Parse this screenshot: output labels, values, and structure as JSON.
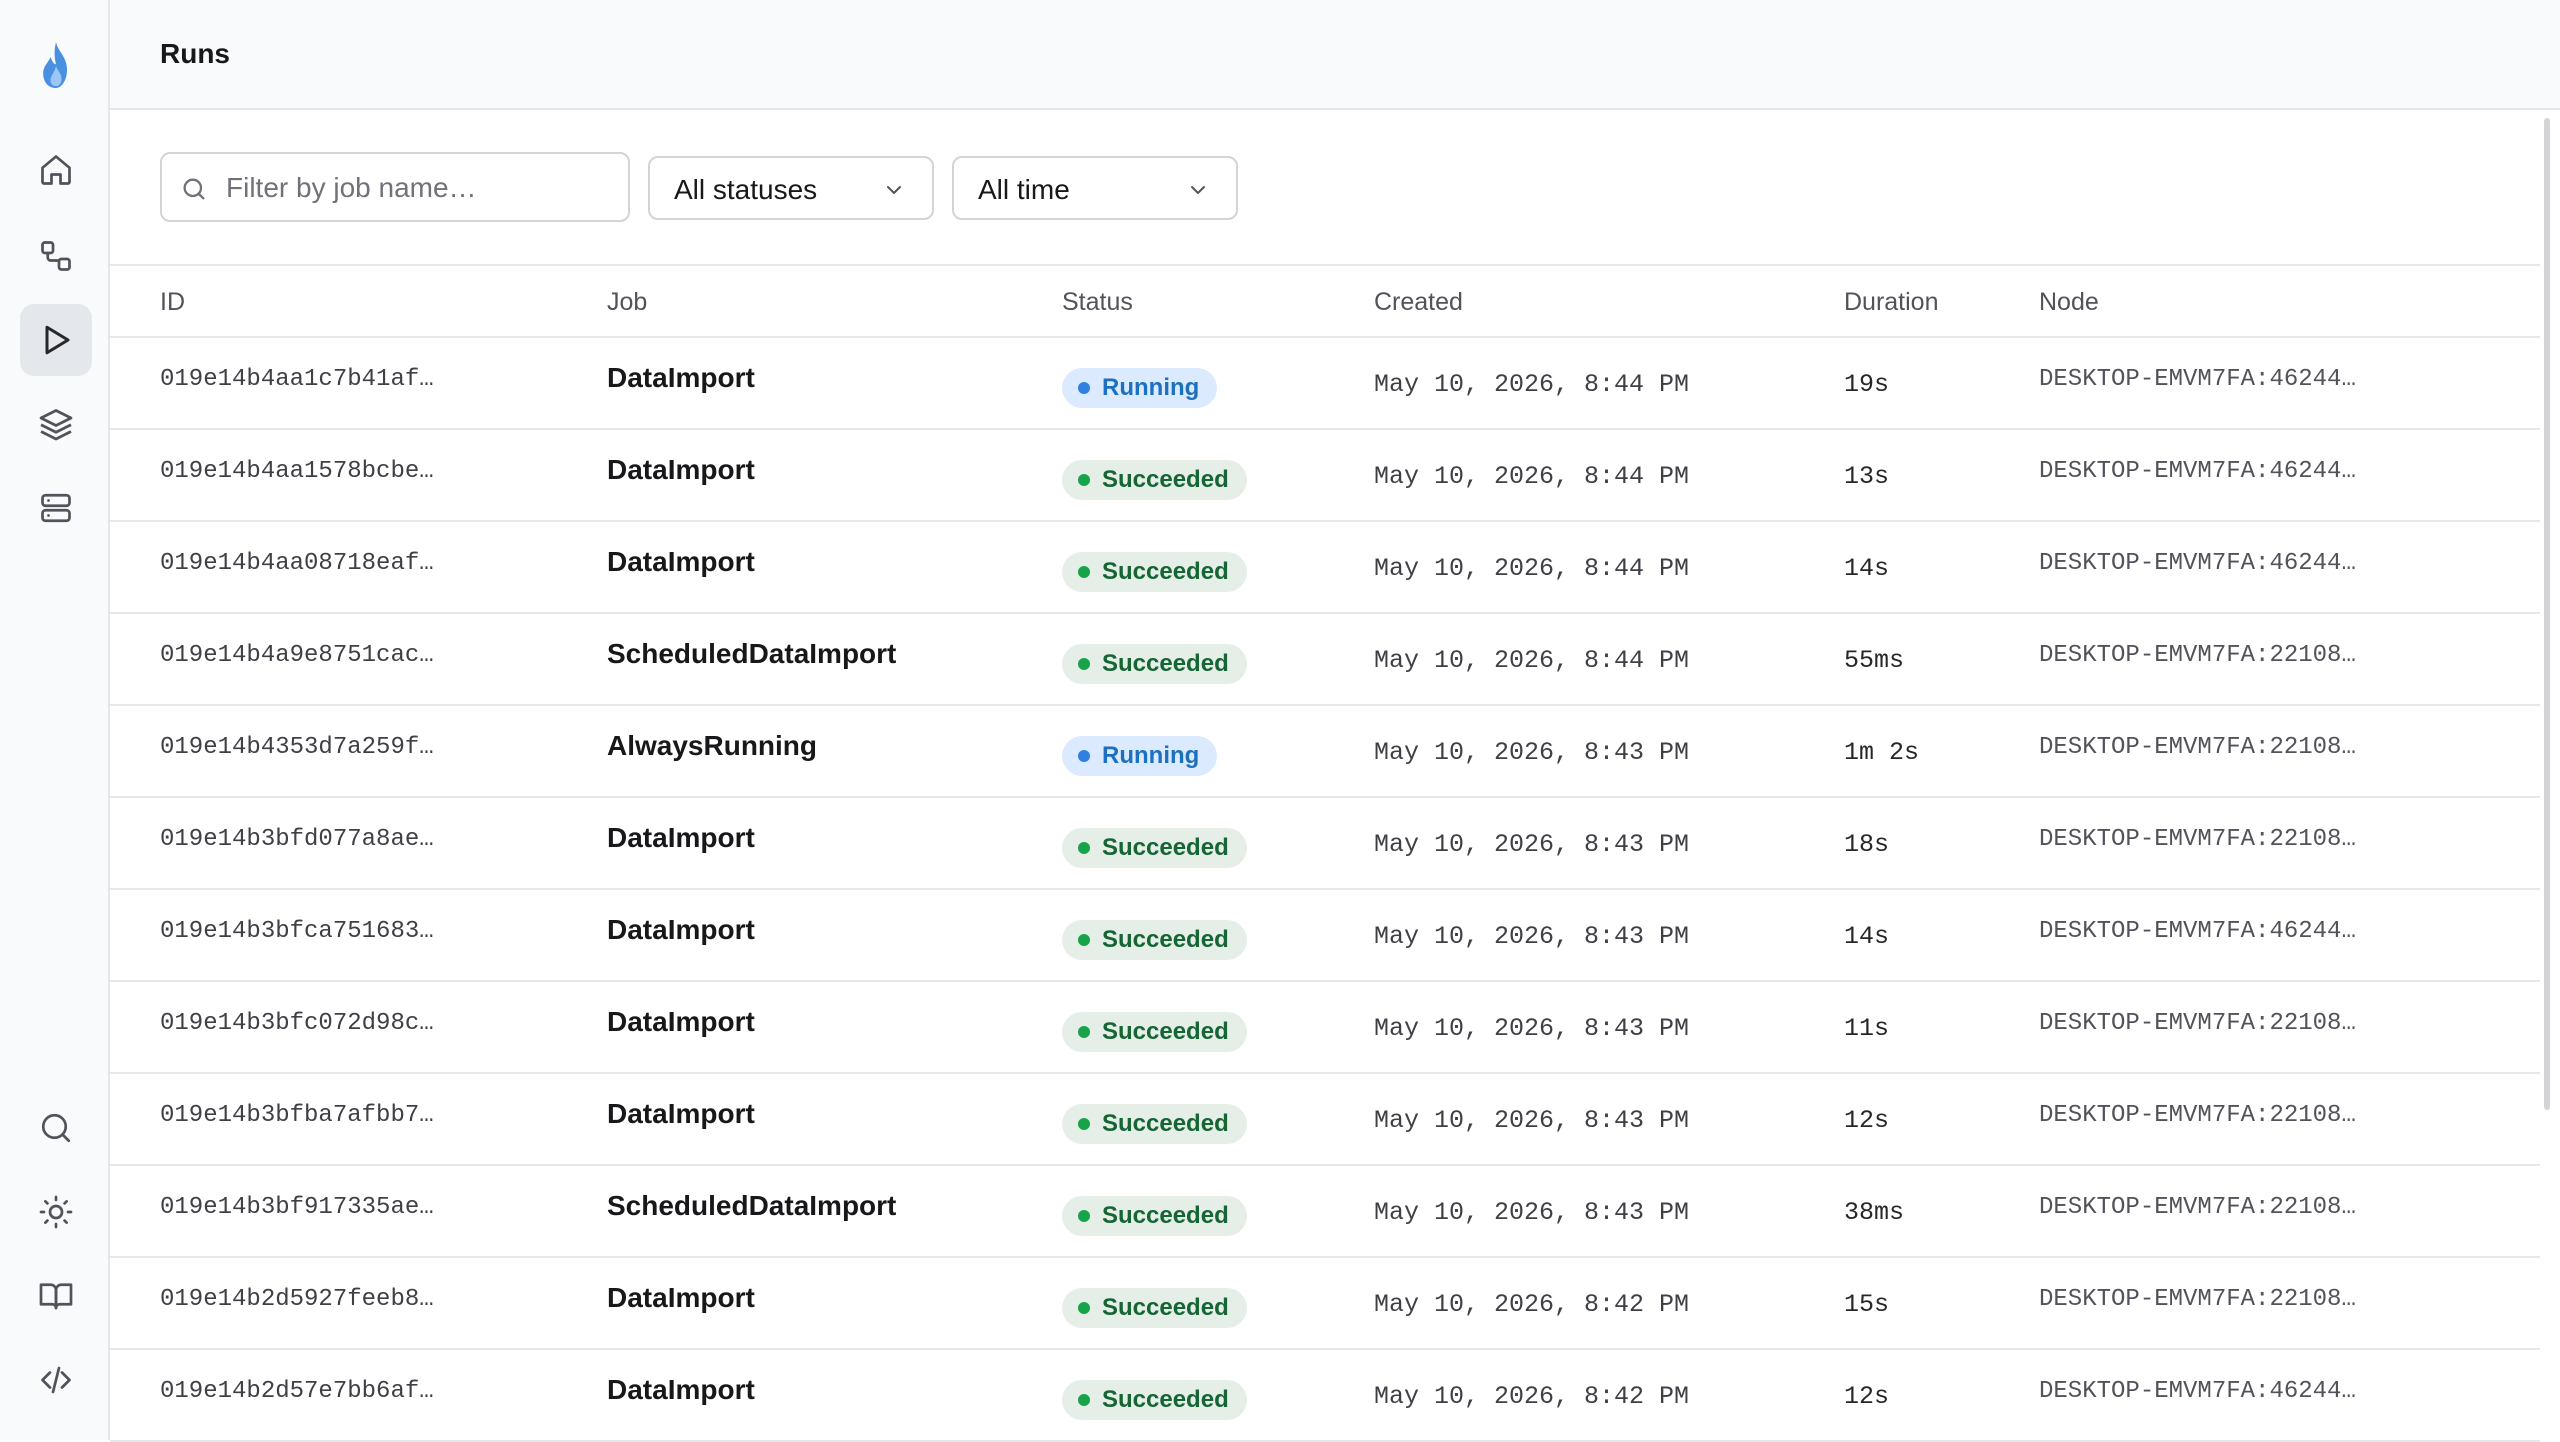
{
  "header": {
    "title": "Runs"
  },
  "sidebar": {
    "logo": "flame-logo",
    "nav_top": [
      {
        "name": "home",
        "icon": "home-icon"
      },
      {
        "name": "workflows",
        "icon": "workflow-icon"
      },
      {
        "name": "runs",
        "icon": "play-icon",
        "active": true
      },
      {
        "name": "layers",
        "icon": "layers-icon"
      },
      {
        "name": "servers",
        "icon": "server-icon"
      }
    ],
    "nav_bottom": [
      {
        "name": "search",
        "icon": "search-icon"
      },
      {
        "name": "theme",
        "icon": "sun-icon"
      },
      {
        "name": "docs",
        "icon": "book-icon"
      },
      {
        "name": "api",
        "icon": "code-icon"
      }
    ]
  },
  "filters": {
    "search_placeholder": "Filter by job name…",
    "status_value": "All statuses",
    "time_value": "All time"
  },
  "table": {
    "headers": {
      "id": "ID",
      "job": "Job",
      "status": "Status",
      "created": "Created",
      "duration": "Duration",
      "node": "Node"
    },
    "rows": [
      {
        "id": "019e14b4aa1c7b41af…",
        "job": "DataImport",
        "status": "Running",
        "created": "May 10, 2026, 8:44 PM",
        "duration": "19s",
        "node": "DESKTOP-EMVM7FA:46244…"
      },
      {
        "id": "019e14b4aa1578bcbe…",
        "job": "DataImport",
        "status": "Succeeded",
        "created": "May 10, 2026, 8:44 PM",
        "duration": "13s",
        "node": "DESKTOP-EMVM7FA:46244…"
      },
      {
        "id": "019e14b4aa08718eaf…",
        "job": "DataImport",
        "status": "Succeeded",
        "created": "May 10, 2026, 8:44 PM",
        "duration": "14s",
        "node": "DESKTOP-EMVM7FA:46244…"
      },
      {
        "id": "019e14b4a9e8751cac…",
        "job": "ScheduledDataImport",
        "status": "Succeeded",
        "created": "May 10, 2026, 8:44 PM",
        "duration": "55ms",
        "node": "DESKTOP-EMVM7FA:22108…"
      },
      {
        "id": "019e14b4353d7a259f…",
        "job": "AlwaysRunning",
        "status": "Running",
        "created": "May 10, 2026, 8:43 PM",
        "duration": "1m 2s",
        "node": "DESKTOP-EMVM7FA:22108…"
      },
      {
        "id": "019e14b3bfd077a8ae…",
        "job": "DataImport",
        "status": "Succeeded",
        "created": "May 10, 2026, 8:43 PM",
        "duration": "18s",
        "node": "DESKTOP-EMVM7FA:22108…"
      },
      {
        "id": "019e14b3bfca751683…",
        "job": "DataImport",
        "status": "Succeeded",
        "created": "May 10, 2026, 8:43 PM",
        "duration": "14s",
        "node": "DESKTOP-EMVM7FA:46244…"
      },
      {
        "id": "019e14b3bfc072d98c…",
        "job": "DataImport",
        "status": "Succeeded",
        "created": "May 10, 2026, 8:43 PM",
        "duration": "11s",
        "node": "DESKTOP-EMVM7FA:22108…"
      },
      {
        "id": "019e14b3bfba7afbb7…",
        "job": "DataImport",
        "status": "Succeeded",
        "created": "May 10, 2026, 8:43 PM",
        "duration": "12s",
        "node": "DESKTOP-EMVM7FA:22108…"
      },
      {
        "id": "019e14b3bf917335ae…",
        "job": "ScheduledDataImport",
        "status": "Succeeded",
        "created": "May 10, 2026, 8:43 PM",
        "duration": "38ms",
        "node": "DESKTOP-EMVM7FA:22108…"
      },
      {
        "id": "019e14b2d5927feeb8…",
        "job": "DataImport",
        "status": "Succeeded",
        "created": "May 10, 2026, 8:42 PM",
        "duration": "15s",
        "node": "DESKTOP-EMVM7FA:22108…"
      },
      {
        "id": "019e14b2d57e7bb6af…",
        "job": "DataImport",
        "status": "Succeeded",
        "created": "May 10, 2026, 8:42 PM",
        "duration": "12s",
        "node": "DESKTOP-EMVM7FA:46244…"
      }
    ]
  },
  "colors": {
    "accent": "#2f80e0",
    "success": "#16a34a",
    "running_bg": "#dbeafe",
    "success_bg": "#e5efe8"
  }
}
